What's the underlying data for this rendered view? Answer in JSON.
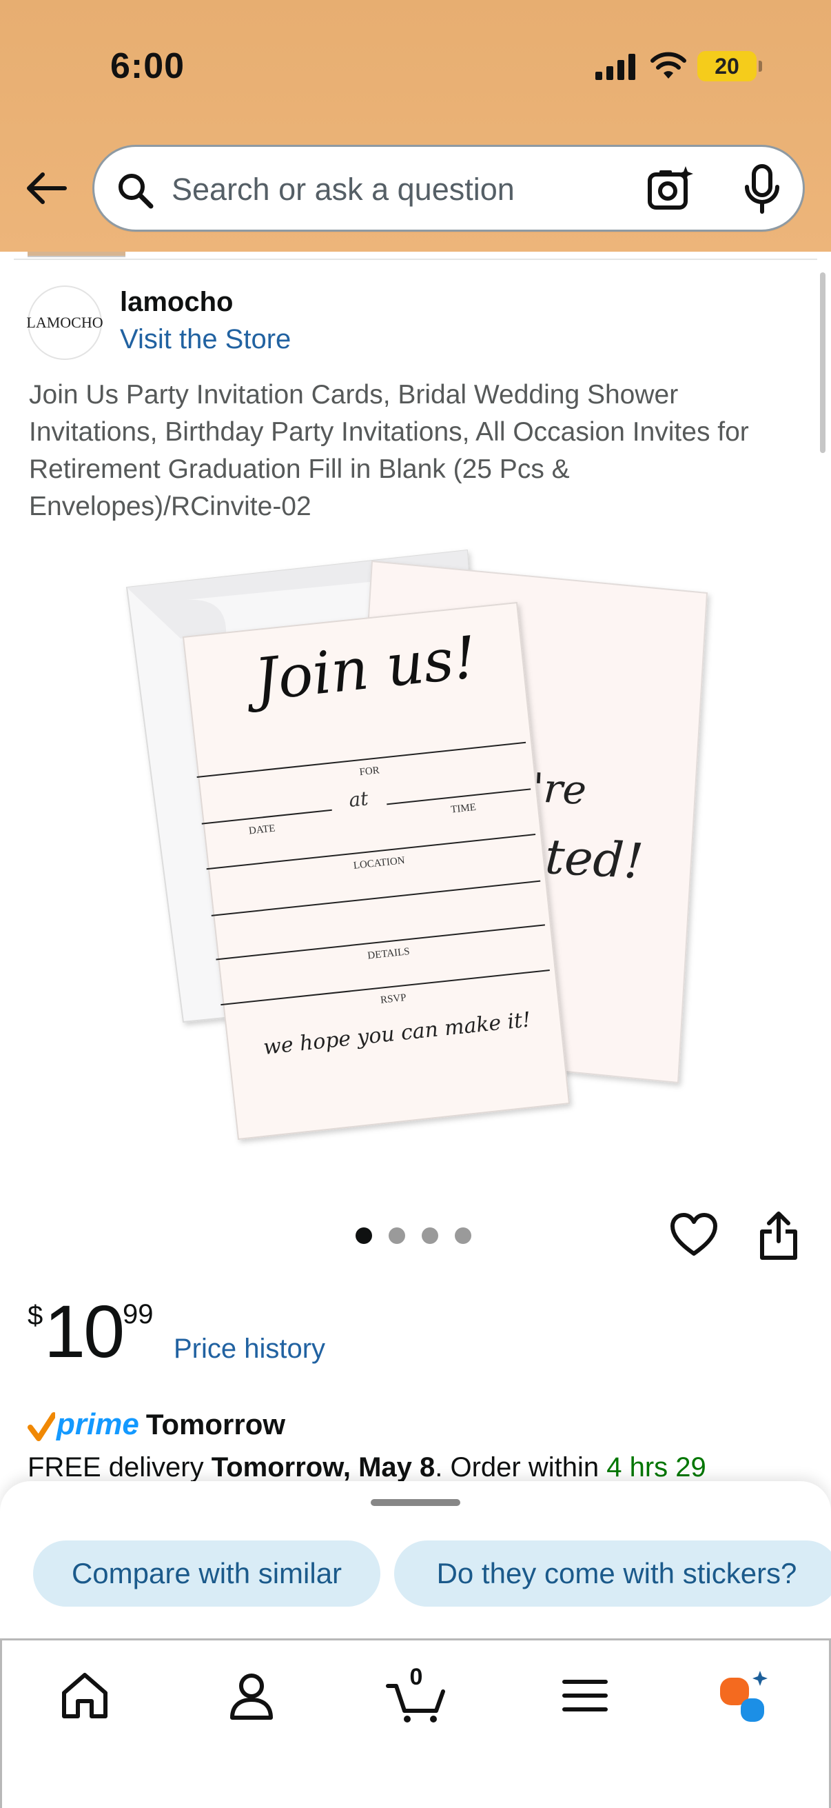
{
  "status_bar": {
    "time": "6:00",
    "battery": "20"
  },
  "search": {
    "placeholder": "Search or ask a question"
  },
  "store": {
    "logo_text": "LAMOCHO",
    "name": "lamocho",
    "link": "Visit the Store"
  },
  "product": {
    "title": "Join Us Party Invitation Cards, Bridal Wedding Shower Invitations, Birthday Party Invitations, All Occasion Invites for Retirement Graduation Fill in Blank (25 Pcs & Envelopes)/RCinvite-02",
    "image": {
      "headline": "Join us!",
      "fields": [
        "FOR",
        "DATE",
        "at",
        "TIME",
        "LOCATION",
        "DETAILS",
        "RSVP"
      ],
      "footer": "we hope you can make it!",
      "back_card": [
        "'re",
        "ted!"
      ]
    },
    "image_count": 4,
    "image_index": 1
  },
  "price": {
    "symbol": "$",
    "whole": "10",
    "fraction": "99",
    "history_link": "Price history"
  },
  "delivery": {
    "prime_label": "prime",
    "speed": "Tomorrow",
    "prefix": "FREE delivery",
    "date": "Tomorrow, May 8",
    "order_within_prefix": ". Order within",
    "countdown": "4 hrs 29"
  },
  "suggestions": [
    "Compare with similar",
    "Do they come with stickers?"
  ],
  "tabs": {
    "cart_count": "0"
  },
  "colors": {
    "header": "#edb57a",
    "link": "#2162a1",
    "chip_bg": "#d9ecf6",
    "prime": "#1399ff",
    "green": "#007600"
  }
}
